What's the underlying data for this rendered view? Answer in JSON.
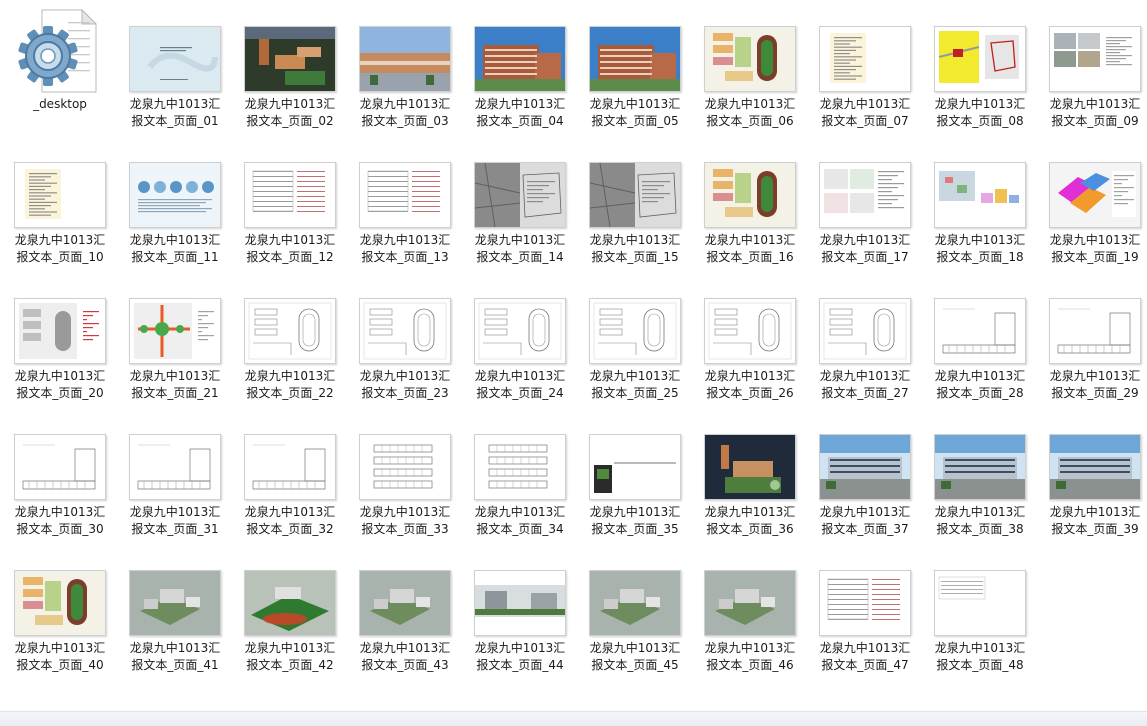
{
  "window": {
    "background": "#ffffff"
  },
  "items": [
    {
      "label": "_desktop",
      "kind": "settings-file",
      "icon": "gear-document-icon"
    },
    {
      "label": "龙泉九中1013汇\n报文本_页面_01",
      "kind": "title-cover"
    },
    {
      "label": "龙泉九中1013汇\n报文本_页面_02",
      "kind": "aerial-render"
    },
    {
      "label": "龙泉九中1013汇\n报文本_页面_03",
      "kind": "street-render"
    },
    {
      "label": "龙泉九中1013汇\n报文本_页面_04",
      "kind": "building-render"
    },
    {
      "label": "龙泉九中1013汇\n报文本_页面_05",
      "kind": "building-render"
    },
    {
      "label": "龙泉九中1013汇\n报文本_页面_06",
      "kind": "color-siteplan"
    },
    {
      "label": "龙泉九中1013汇\n报文本_页面_07",
      "kind": "text-page"
    },
    {
      "label": "龙泉九中1013汇\n报文本_页面_08",
      "kind": "location-map"
    },
    {
      "label": "龙泉九中1013汇\n报文本_页面_09",
      "kind": "photo-grid"
    },
    {
      "label": "龙泉九中1013汇\n报文本_页面_10",
      "kind": "text-page"
    },
    {
      "label": "龙泉九中1013汇\n报文本_页面_11",
      "kind": "diagram-circles"
    },
    {
      "label": "龙泉九中1013汇\n报文本_页面_12",
      "kind": "table-page"
    },
    {
      "label": "龙泉九中1013汇\n报文本_页面_13",
      "kind": "table-page"
    },
    {
      "label": "龙泉九中1013汇\n报文本_页面_14",
      "kind": "gray-map"
    },
    {
      "label": "龙泉九中1013汇\n报文本_页面_15",
      "kind": "gray-map"
    },
    {
      "label": "龙泉九中1013汇\n报文本_页面_16",
      "kind": "color-siteplan"
    },
    {
      "label": "龙泉九中1013汇\n报文本_页面_17",
      "kind": "diagram-small"
    },
    {
      "label": "龙泉九中1013汇\n报文本_页面_18",
      "kind": "diagram-3d"
    },
    {
      "label": "龙泉九中1013汇\n报文本_页面_19",
      "kind": "diagram-3d-color"
    },
    {
      "label": "龙泉九中1013汇\n报文本_页面_20",
      "kind": "gray-siteplan"
    },
    {
      "label": "龙泉九中1013汇\n报文本_页面_21",
      "kind": "circulation"
    },
    {
      "label": "龙泉九中1013汇\n报文本_页面_22",
      "kind": "line-plan"
    },
    {
      "label": "龙泉九中1013汇\n报文本_页面_23",
      "kind": "line-plan"
    },
    {
      "label": "龙泉九中1013汇\n报文本_页面_24",
      "kind": "line-plan"
    },
    {
      "label": "龙泉九中1013汇\n报文本_页面_25",
      "kind": "line-plan"
    },
    {
      "label": "龙泉九中1013汇\n报文本_页面_26",
      "kind": "line-plan"
    },
    {
      "label": "龙泉九中1013汇\n报文本_页面_27",
      "kind": "line-plan"
    },
    {
      "label": "龙泉九中1013汇\n报文本_页面_28",
      "kind": "floor-plan"
    },
    {
      "label": "龙泉九中1013汇\n报文本_页面_29",
      "kind": "floor-plan"
    },
    {
      "label": "龙泉九中1013汇\n报文本_页面_30",
      "kind": "floor-plan"
    },
    {
      "label": "龙泉九中1013汇\n报文本_页面_31",
      "kind": "floor-plan"
    },
    {
      "label": "龙泉九中1013汇\n报文本_页面_32",
      "kind": "floor-plan"
    },
    {
      "label": "龙泉九中1013汇\n报文本_页面_33",
      "kind": "floor-plan-rows"
    },
    {
      "label": "龙泉九中1013汇\n报文本_页面_34",
      "kind": "floor-plan-rows"
    },
    {
      "label": "龙泉九中1013汇\n报文本_页面_35",
      "kind": "dark-inset"
    },
    {
      "label": "龙泉九中1013汇\n报文本_页面_36",
      "kind": "aerial-dark"
    },
    {
      "label": "龙泉九中1013汇\n报文本_页面_37",
      "kind": "sky-render"
    },
    {
      "label": "龙泉九中1013汇\n报文本_页面_38",
      "kind": "sky-render"
    },
    {
      "label": "龙泉九中1013汇\n报文本_页面_39",
      "kind": "sky-render"
    },
    {
      "label": "龙泉九中1013汇\n报文本_页面_40",
      "kind": "color-siteplan"
    },
    {
      "label": "龙泉九中1013汇\n报文本_页面_41",
      "kind": "model-3d"
    },
    {
      "label": "龙泉九中1013汇\n报文本_页面_42",
      "kind": "model-3d-green"
    },
    {
      "label": "龙泉九中1013汇\n报文本_页面_43",
      "kind": "model-3d"
    },
    {
      "label": "龙泉九中1013汇\n报文本_页面_44",
      "kind": "model-street"
    },
    {
      "label": "龙泉九中1013汇\n报文本_页面_45",
      "kind": "model-3d"
    },
    {
      "label": "龙泉九中1013汇\n报文本_页面_46",
      "kind": "model-3d"
    },
    {
      "label": "龙泉九中1013汇\n报文本_页面_47",
      "kind": "table-page"
    },
    {
      "label": "龙泉九中1013汇\n报文本_页面_48",
      "kind": "small-table"
    }
  ]
}
